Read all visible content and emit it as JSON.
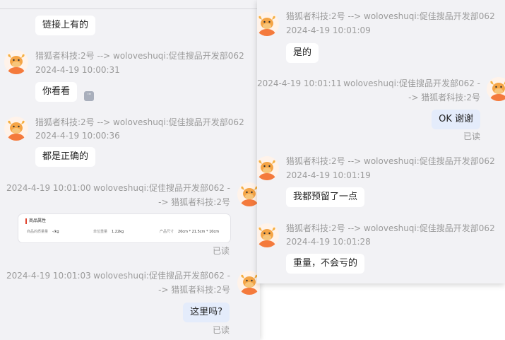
{
  "left": {
    "top_message": "链接上有的",
    "messages": [
      {
        "sender": "猎狐者科技:2号 --> woloveshuqi:促佳搜品开发部062",
        "time": "2024-4-19 10:00:31",
        "text": "你看看",
        "more": "···"
      },
      {
        "sender": "猎狐者科技:2号 --> woloveshuqi:促佳搜品开发部062",
        "time": "2024-4-19 10:00:36",
        "text": "都是正确的"
      }
    ],
    "sent": [
      {
        "time": "2024-4-19 10:01:00",
        "sender_line1": "woloveshuqi:促佳搜品开发部062 -",
        "sender_line2": "-> 猎狐者科技:2号",
        "read": "已读"
      },
      {
        "time": "2024-4-19 10:01:03",
        "sender_line1": "woloveshuqi:促佳搜品开发部062 -",
        "sender_line2": "-> 猎狐者科技:2号",
        "text": "这里吗?",
        "read": "已读"
      }
    ],
    "card": {
      "title": "商品属性",
      "cells": [
        {
          "label": "商品的质量量",
          "value": "-/kg"
        },
        {
          "label": "单位重量",
          "value": "1.22kg"
        },
        {
          "label": "产品尺寸",
          "value": "20cm * 21.5cm * 10cm"
        }
      ]
    }
  },
  "right": {
    "messages": [
      {
        "sender": "猎狐者科技:2号 --> woloveshuqi:促佳搜品开发部062",
        "time": "2024-4-19 10:01:09",
        "text": "是的"
      },
      {
        "sender": "猎狐者科技:2号 --> woloveshuqi:促佳搜品开发部062",
        "time": "2024-4-19 10:01:19",
        "text": "我都预留了一点"
      },
      {
        "sender": "猎狐者科技:2号 --> woloveshuqi:促佳搜品开发部062",
        "time": "2024-4-19 10:01:28",
        "text": "重量，不会亏的"
      }
    ],
    "sent": {
      "time": "2024-4-19 10:01:11",
      "sender_line1": "woloveshuqi:促佳搜品开发部062 -",
      "sender_line2": "-> 猎狐者科技:2号",
      "text": "OK 谢谢",
      "read": "已读"
    }
  },
  "colors": {
    "panel_bg": "#f2f2f5",
    "bubble_bg": "#ffffff",
    "mine_bubble_bg": "#e4ecfb",
    "meta_text": "#9b9b9b",
    "avatar_orange": "#f47a3c"
  },
  "avatar_icon": "bull-mascot-icon"
}
